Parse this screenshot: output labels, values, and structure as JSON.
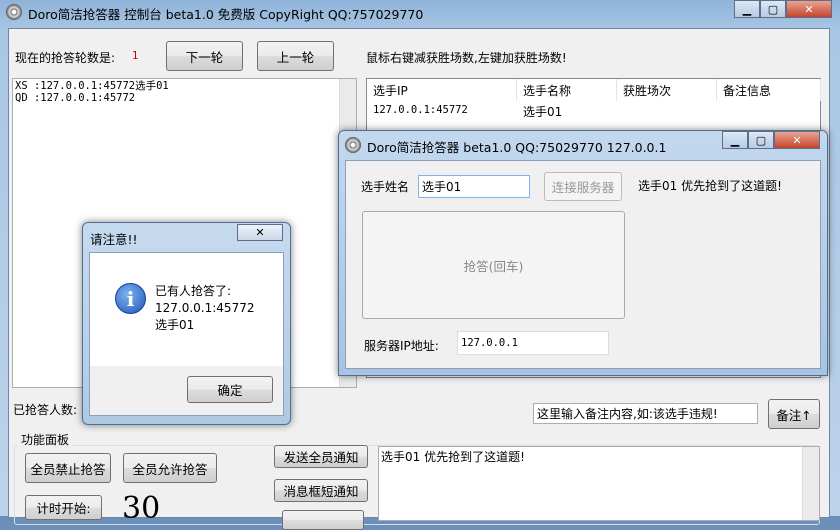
{
  "main": {
    "title": "Doro简洁抢答器 控制台 beta1.0 免费版  CopyRight QQ:757029770",
    "round_label": "现在的抢答轮数是:",
    "round_value": "1",
    "next_round": "下一轮",
    "prev_round": "上一轮",
    "hint": "鼠标右键减获胜场数,左键加获胜场数!",
    "log": [
      "XS :127.0.0.1:45772选手01",
      "QD :127.0.0.1:45772"
    ],
    "table": {
      "columns": [
        "选手IP",
        "选手名称",
        "获胜场次",
        "备注信息"
      ],
      "rows": [
        [
          "127.0.0.1:45772",
          "选手01",
          "",
          ""
        ]
      ]
    },
    "answered_label": "已抢答人数:",
    "note_input": "这里输入备注内容,如:该选手违规!",
    "note_button": "备注↑",
    "panel_title": "功能面板",
    "ban_all": "全员禁止抢答",
    "allow_all": "全员允许抢答",
    "send_notice": "发送全员通知",
    "msgbox_notice": "消息框短通知",
    "timer_start": "计时开始:",
    "timer_value": "30",
    "message_log": "选手01 优先抢到了这道题!"
  },
  "client": {
    "title": "Doro简洁抢答器 beta1.0 QQ:75029770  127.0.0.1",
    "name_label": "选手姓名",
    "name_value": "选手01",
    "connect_button": "连接服务器",
    "status": "选手01  优先抢到了这道题!",
    "buzz_button": "抢答(回车)",
    "ip_label": "服务器IP地址:",
    "ip_value": "127.0.0.1"
  },
  "dialog": {
    "title": "请注意!!",
    "lines": [
      "已有人抢答了:",
      "127.0.0.1:45772",
      "选手01"
    ],
    "ok": "确定"
  }
}
